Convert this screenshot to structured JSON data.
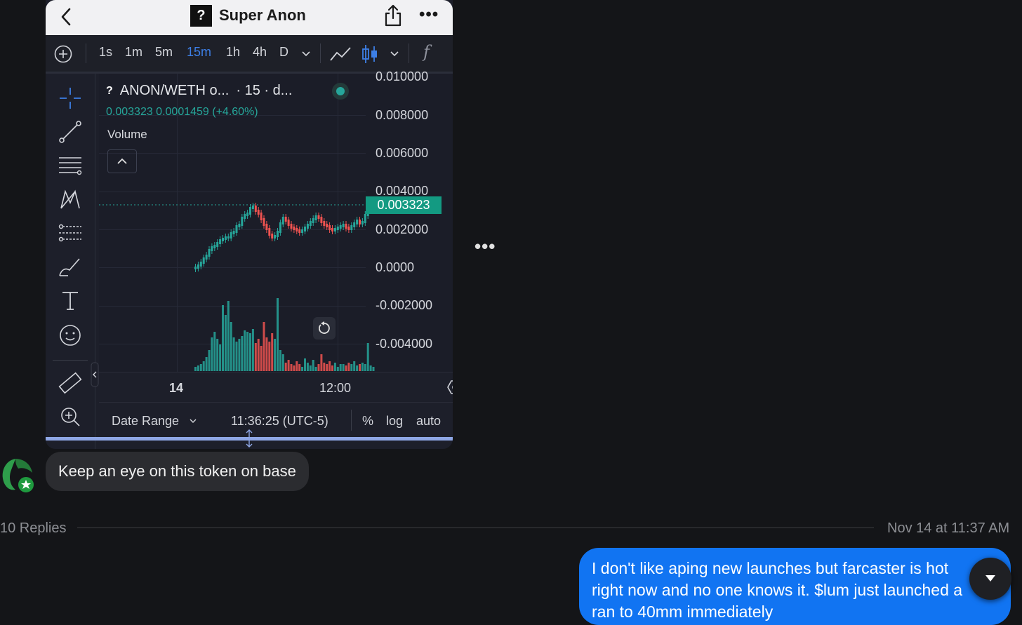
{
  "header": {
    "title": "Super Anon",
    "token_icon_glyph": "?"
  },
  "toolbar": {
    "intervals": [
      "1s",
      "1m",
      "5m",
      "15m",
      "1h",
      "4h",
      "D"
    ],
    "active_interval": "15m",
    "fx_label": "f"
  },
  "chart": {
    "symbol_glyph": "?",
    "symbol": "ANON/WETH o...",
    "interval_label": "· 15 · d...",
    "ohlc_text": "0.003323  0.0001459 (+4.60%)",
    "volume_label": "Volume",
    "status_color": "#26a69a",
    "y_axis_labels": [
      "0.010000",
      "0.008000",
      "0.006000",
      "0.004000",
      "0.002000",
      "0.0000",
      "-0.002000",
      "-0.004000"
    ],
    "current_price": "0.003323",
    "x_axis_labels": [
      "14",
      "12:00"
    ],
    "up_color": "#26a69a",
    "down_color": "#ef5350"
  },
  "bottom_bar": {
    "date_range": "Date Range",
    "clock": "11:36:25 (UTC-5)",
    "percent": "%",
    "log": "log",
    "auto": "auto"
  },
  "messages": {
    "incoming": "Keep an eye on this token on base",
    "replies": "10 Replies",
    "timestamp": "Nov 14 at 11:37 AM",
    "outgoing_lines": [
      "I don't like aping new launches but farcaster is hot",
      "right now and no one knows it. $lum just launched a",
      "ran to 40mm immediately"
    ]
  },
  "colors": {
    "accent_blue": "#1174f2",
    "background": "#141518"
  }
}
